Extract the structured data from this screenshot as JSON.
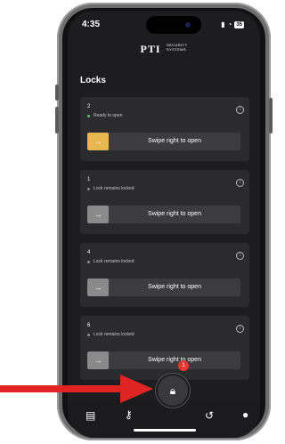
{
  "status_bar": {
    "time": "4:35",
    "battery": "35"
  },
  "header": {
    "logo_main": "PTI",
    "logo_sub_1": "SECURITY",
    "logo_sub_2": "SYSTEMS"
  },
  "page": {
    "title": "Locks"
  },
  "locks": [
    {
      "number": "2",
      "status": "Ready to open",
      "status_color": "#5fbf6a",
      "handle_color": "#e6b84f",
      "slider_label": "Swipe right to open"
    },
    {
      "number": "1",
      "status": "Lock remains locked",
      "status_color": "#8a8a8a",
      "handle_color": "#8a8a8a",
      "slider_label": "Swipe right to open"
    },
    {
      "number": "4",
      "status": "Lock remains locked",
      "status_color": "#8a8a8a",
      "handle_color": "#8a8a8a",
      "slider_label": "Swipe right to open"
    },
    {
      "number": "6",
      "status": "Lock remains locked",
      "status_color": "#8a8a8a",
      "handle_color": "#8a8a8a",
      "slider_label": "Swipe right to open"
    }
  ],
  "bottom_nav": {
    "center_badge": "1",
    "icons": [
      "building-icon",
      "key-icon",
      "lock-icon",
      "history-icon",
      "person-icon"
    ]
  },
  "colors": {
    "background": "#1d1d1f",
    "card": "#2b2b2d",
    "accent": "#e6b84f",
    "annotation_arrow": "#e02424"
  }
}
